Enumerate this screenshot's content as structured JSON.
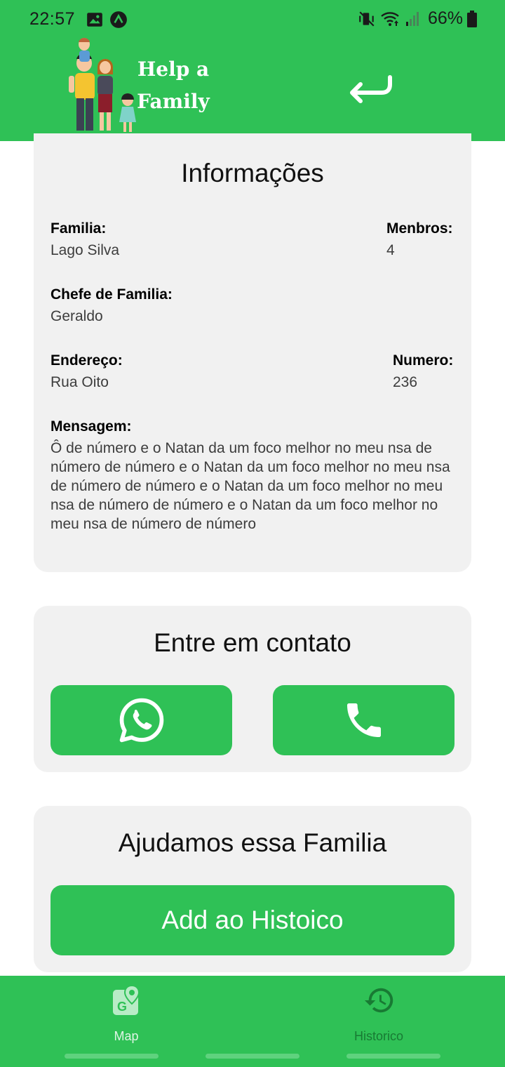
{
  "status_bar": {
    "time": "22:57",
    "battery": "66%",
    "icons": [
      "gallery-icon",
      "app-notification-icon",
      "mute-vibrate-icon",
      "wifi-icon",
      "signal-icon",
      "battery-icon"
    ]
  },
  "header": {
    "title_line1": "Help a",
    "title_line2": "Family",
    "back_icon": "return-arrow-icon"
  },
  "info_card": {
    "title": "Informações",
    "familia_label": "Familia:",
    "familia_value": "Lago Silva",
    "membros_label": "Menbros:",
    "membros_value": "4",
    "chefe_label": "Chefe de Familia:",
    "chefe_value": "Geraldo",
    "endereco_label": "Endereço:",
    "endereco_value": "Rua Oito",
    "numero_label": "Numero:",
    "numero_value": "236",
    "mensagem_label": "Mensagem:",
    "mensagem_value": "Ô de número e o Natan da um foco melhor no meu nsa de número de número e o Natan da um foco melhor no meu nsa de número de número e o Natan da um foco melhor no meu nsa de número de número e o Natan da um foco melhor no meu nsa de número de número"
  },
  "contact_card": {
    "title": "Entre em contato",
    "whatsapp_icon": "whatsapp-icon",
    "phone_icon": "phone-icon"
  },
  "helped_card": {
    "title": "Ajudamos essa Familia",
    "add_button": "Add ao Histoico"
  },
  "bottom_nav": {
    "items": [
      {
        "label": "Map",
        "icon": "map-pin-icon",
        "active": true
      },
      {
        "label": "Historico",
        "icon": "history-icon",
        "active": false
      }
    ]
  },
  "colors": {
    "primary": "#2fc156",
    "card": "#f1f1f1",
    "nav_inactive": "#187a33"
  }
}
